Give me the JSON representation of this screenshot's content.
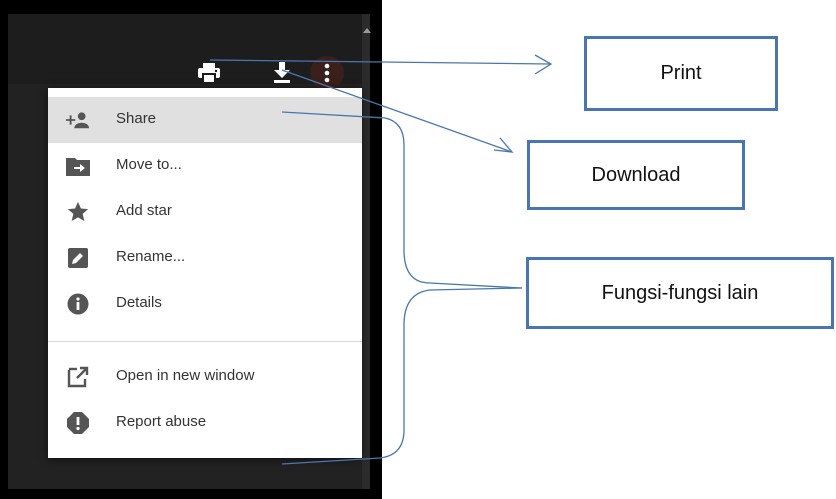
{
  "toolbar": {
    "print_icon": "print-icon",
    "download_icon": "download-icon",
    "more_icon": "more-vert-icon"
  },
  "menu": {
    "items": [
      {
        "label": "Share",
        "icon": "person-add-icon"
      },
      {
        "label": "Move to...",
        "icon": "folder-move-icon"
      },
      {
        "label": "Add star",
        "icon": "star-icon"
      },
      {
        "label": "Rename...",
        "icon": "rename-icon"
      },
      {
        "label": "Details",
        "icon": "info-icon"
      },
      {
        "label": "Open in new window",
        "icon": "open-new-window-icon"
      },
      {
        "label": "Report abuse",
        "icon": "report-icon"
      }
    ]
  },
  "callouts": {
    "print": "Print",
    "download": "Download",
    "other_functions": "Fungsi-fungsi lain"
  },
  "colors": {
    "accent_line": "#4a76b0",
    "menu_highlight": "#e0e0e0",
    "viewer_background": "#222222"
  }
}
